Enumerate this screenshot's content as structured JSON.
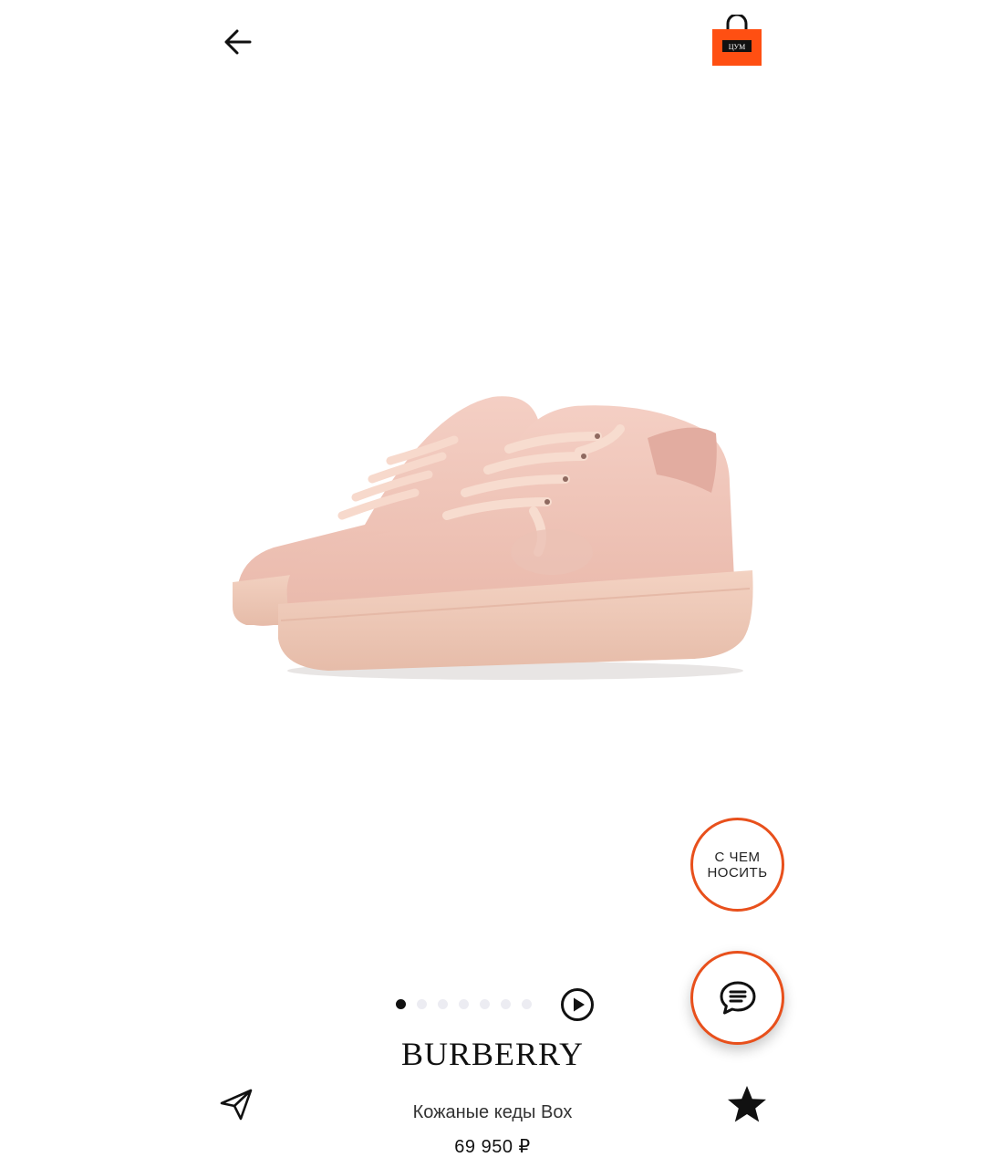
{
  "header": {
    "back_icon": "arrow-left-icon",
    "bag_icon": "shopping-bag-icon",
    "bag_badge": "ЦУМ",
    "accent_color": "#ff4f12"
  },
  "product": {
    "brand": "BURBERRY",
    "name": "Кожаные кеды Box",
    "price": "69 950 ₽",
    "image_icon": "sneakers-image"
  },
  "carousel": {
    "total_slides": 7,
    "active_index": 0,
    "play_icon": "play-circle-icon"
  },
  "actions": {
    "outfit_label": "С ЧЕМ\nНОСИТЬ",
    "chat_icon": "chat-bubble-icon",
    "share_icon": "send-icon",
    "favorite_icon": "star-icon",
    "ring_color": "#e8501c"
  }
}
